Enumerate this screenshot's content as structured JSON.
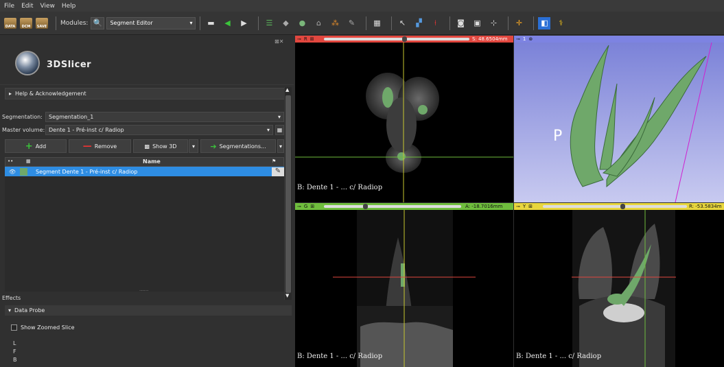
{
  "menu": [
    "File",
    "Edit",
    "View",
    "Help"
  ],
  "toolbar": {
    "data_label": "DATA",
    "dcm_label": "DCM",
    "save_label": "SAVE",
    "modules_label": "Modules:",
    "module_selected": "Segment Editor"
  },
  "app": {
    "logo_text": "3DSlicer"
  },
  "panel": {
    "help_label": "Help & Acknowledgement",
    "segmentation_label": "Segmentation:",
    "segmentation_value": "Segmentation_1",
    "master_label": "Master volume:",
    "master_value": "Dente 1 - Pré-inst c/ Radiop",
    "add_label": "Add",
    "remove_label": "Remove",
    "show3d_label": "Show 3D",
    "segmentations_label": "Segmentations...",
    "table_name_header": "Name",
    "segment_name": "Segment Dente 1 - Pré-inst c/ Radiop",
    "effects_label": "Effects",
    "data_probe_label": "Data Probe",
    "show_zoomed_label": "Show Zoomed Slice",
    "probe_letters": [
      "L",
      "F",
      "B"
    ],
    "splitter_dots": "......"
  },
  "views": {
    "red": {
      "name": "R",
      "readout": "S: 48.6504mm",
      "slider_fraction": 0.55,
      "label": "B: Dente 1 - ... c/ Radiop"
    },
    "threed": {
      "name": "1",
      "orientation_letter": "P"
    },
    "green": {
      "name": "G",
      "readout": "A: -18.7016mm",
      "slider_fraction": 0.3,
      "label": "B: Dente 1 - ... c/ Radiop"
    },
    "yellow": {
      "name": "Y",
      "readout": "R: -53.5834m",
      "slider_fraction": 0.55,
      "label": "B: Dente 1 - ... c/ Radiop"
    }
  },
  "colors": {
    "red_bar": "#e2473f",
    "green_bar": "#6fbd3d",
    "yellow_bar": "#e8d63d",
    "blue_bar": "#7d83e2",
    "selected_row": "#2e8de3",
    "segment_green": "#6fa86a"
  }
}
